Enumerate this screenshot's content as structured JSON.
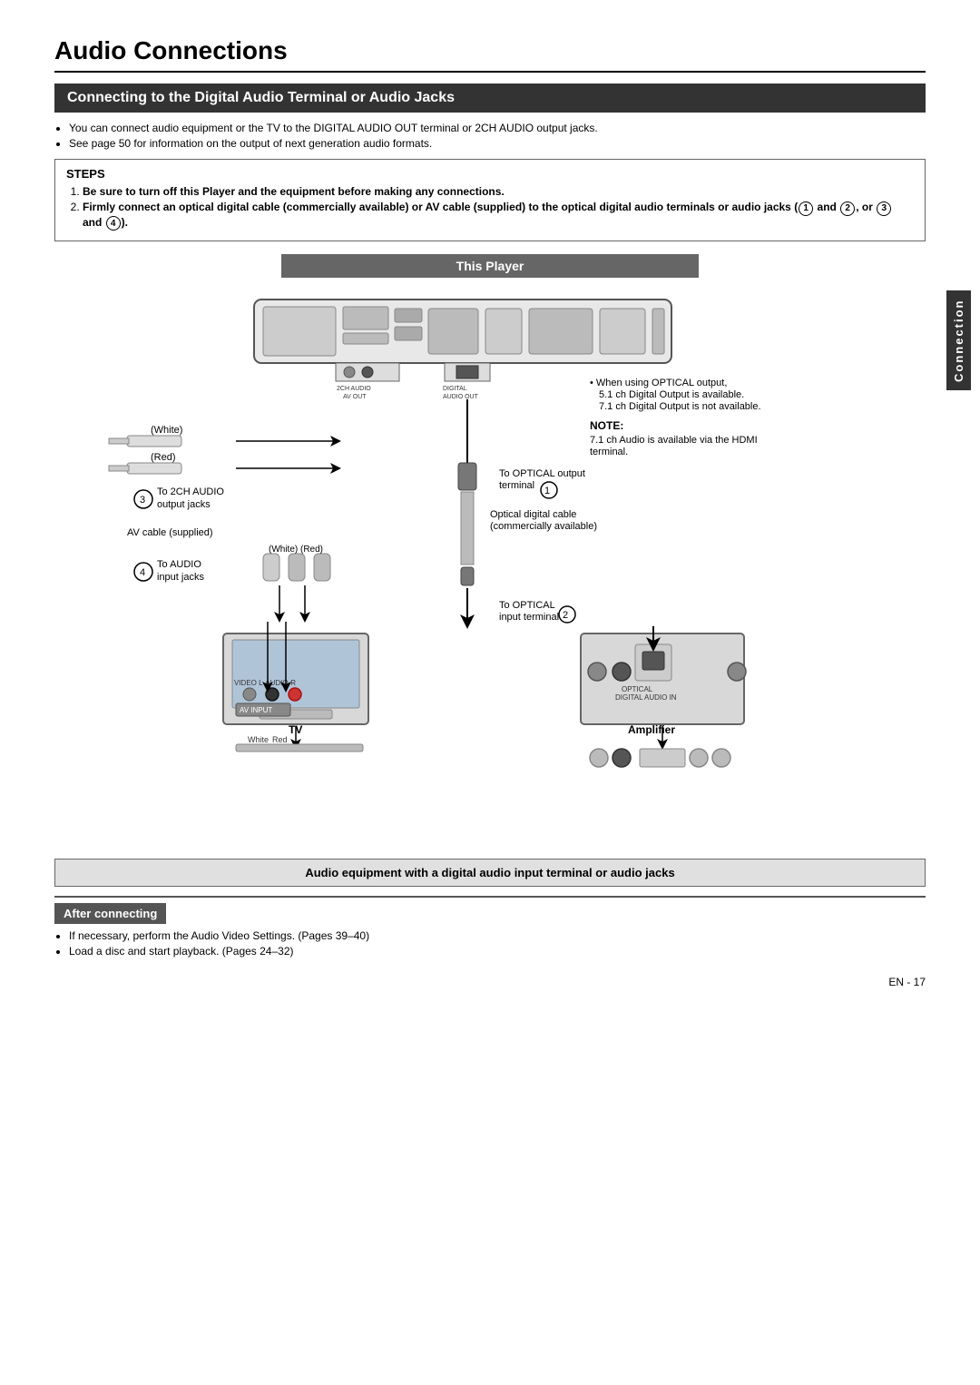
{
  "page": {
    "title": "Audio Connections",
    "section_title": "Connecting to the Digital Audio Terminal or Audio Jacks",
    "bullets": [
      "You can connect audio equipment or the TV to the DIGITAL AUDIO OUT terminal or 2CH AUDIO output jacks.",
      "See page 50 for information on the output of next generation audio formats."
    ],
    "steps_title": "STEPS",
    "steps": [
      "Be sure to turn off this Player and the equipment before making any connections.",
      "Firmly connect an optical digital cable (commercially available) or AV cable (supplied) to the optical digital audio terminals or audio jacks (① and ②, or ③ and ④)."
    ],
    "this_player_label": "This Player",
    "sidebar_label": "Connection",
    "note_title": "NOTE:",
    "note_text": "7.1 ch Audio is available via the HDMI terminal.",
    "optical_note_1": "When using OPTICAL output,",
    "optical_note_2": "5.1 ch Digital Output is available.",
    "optical_note_3": "7.1 ch Digital Output is not available.",
    "label_to_optical_output": "To OPTICAL output terminal",
    "label_to_optical_input": "To OPTICAL input terminal",
    "label_optical_cable": "Optical digital cable (commercially available)",
    "label_to_2ch_audio": "To 2CH AUDIO output jacks",
    "label_av_cable": "AV cable (supplied)",
    "label_to_audio_input": "To AUDIO input jacks",
    "label_white": "White",
    "label_red": "Red",
    "label_tv": "TV",
    "label_amplifier": "Amplifier",
    "label_white_red_bottom": "(White) (Red)",
    "circle_1": "①",
    "circle_2": "②",
    "circle_3": "③",
    "circle_4": "④",
    "bottom_section_title": "Audio equipment with a digital audio input terminal or audio jacks",
    "after_connecting_title": "After connecting",
    "after_connecting_bullets": [
      "If necessary, perform the Audio Video Settings. (Pages 39–40)",
      "Load a disc and start playback. (Pages 24–32)"
    ],
    "page_number": "EN  -  17"
  }
}
